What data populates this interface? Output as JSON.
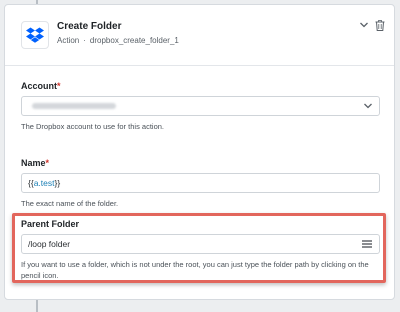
{
  "step": {
    "title": "Create Folder",
    "type_label": "Action",
    "separator": "·",
    "instance_name": "dropbox_create_folder_1",
    "app_icon": "dropbox-icon"
  },
  "header_actions": {
    "collapse_icon": "chevron-down-icon",
    "delete_icon": "trash-icon"
  },
  "fields": {
    "account": {
      "label": "Account",
      "required_mark": "*",
      "selected_value": "",
      "help": "The Dropbox account to use for this action."
    },
    "name": {
      "label": "Name",
      "required_mark": "*",
      "value_prefix": "{{",
      "value_token": "a.test",
      "value_suffix": "}}",
      "help": "The exact name of the folder."
    },
    "parent_folder": {
      "label": "Parent Folder",
      "value": "/loop folder",
      "menu_icon": "hamburger-icon",
      "help": "If you want to use a folder, which is not under the root, you can just type the folder path by clicking on the pencil icon."
    }
  },
  "colors": {
    "highlight_border": "#e2665c",
    "required": "#d0342c",
    "token": "#1a7fb5",
    "dropbox_blue": "#0061fe"
  }
}
